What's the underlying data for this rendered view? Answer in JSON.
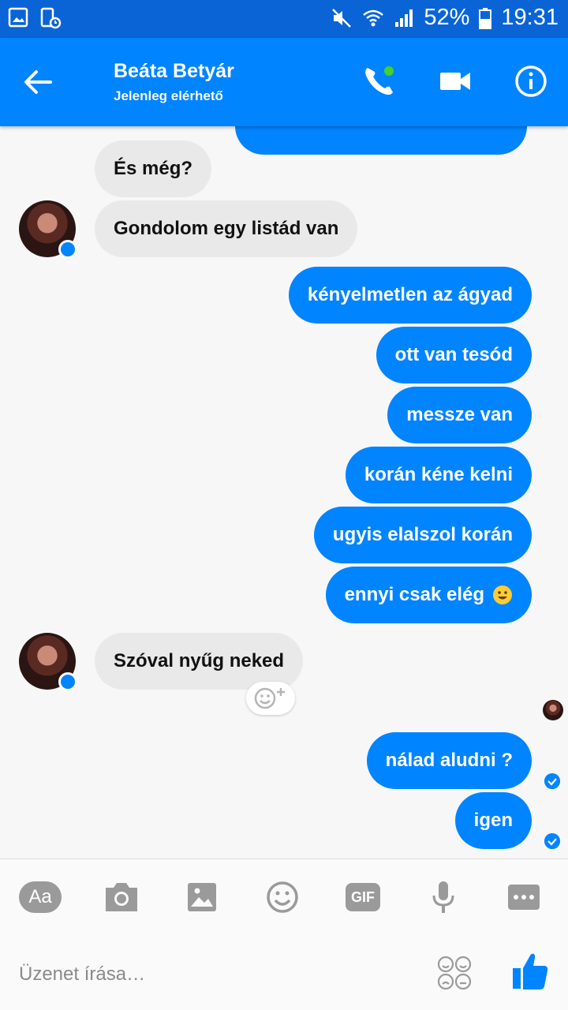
{
  "status_bar": {
    "battery": "52%",
    "time": "19:31"
  },
  "header": {
    "title": "Beáta Betyár",
    "subtitle": "Jelenleg elérhető"
  },
  "messages": [
    {
      "dir": "in",
      "text": "És még?"
    },
    {
      "dir": "in",
      "text": "Gondolom egy listád van"
    },
    {
      "dir": "out",
      "text": "kényelmetlen az ágyad"
    },
    {
      "dir": "out",
      "text": "ott van tesód"
    },
    {
      "dir": "out",
      "text": "messze van"
    },
    {
      "dir": "out",
      "text": "korán kéne kelni"
    },
    {
      "dir": "out",
      "text": "ugyis elalszol korán"
    },
    {
      "dir": "out",
      "text": "ennyi csak elég"
    },
    {
      "dir": "in",
      "text": "Szóval nyűg neked"
    },
    {
      "dir": "out",
      "text": "nálad aludni ?"
    },
    {
      "dir": "out",
      "text": "igen"
    }
  ],
  "composer": {
    "aa_label": "Aa",
    "gif_label": "GIF",
    "placeholder": "Üzenet írása…"
  },
  "colors": {
    "brand_blue": "#0084ff",
    "status_blue": "#0a64d6",
    "incoming_bubble": "#e9e9e9"
  },
  "icons": [
    "back-arrow-icon",
    "phone-icon",
    "video-camera-icon",
    "info-icon",
    "camera-icon",
    "image-icon",
    "emoji-icon",
    "microphone-icon",
    "more-icon",
    "stickers-icon",
    "thumbs-up-icon"
  ]
}
